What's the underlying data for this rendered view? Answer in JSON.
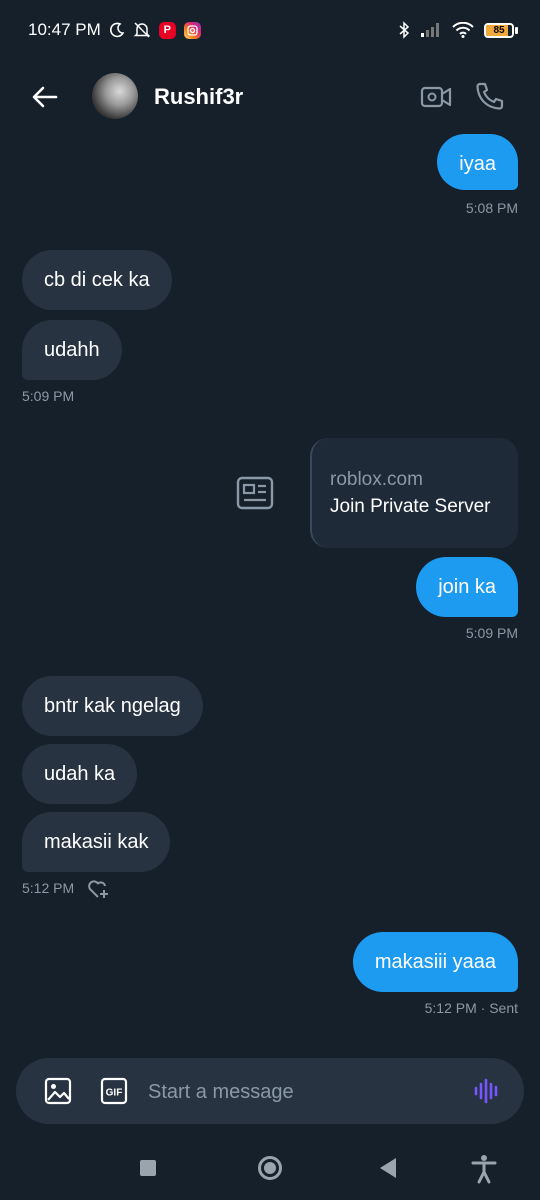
{
  "status_bar": {
    "time": "10:47 PM",
    "battery_level": "85",
    "icons": [
      "moon-icon",
      "bell-off-icon",
      "pinterest-icon",
      "instagram-icon",
      "bluetooth-icon",
      "signal-icon",
      "wifi-icon",
      "battery-icon"
    ],
    "colors": {
      "battery_fill": "#f2a93b",
      "pinterest": "#e60023",
      "instagram": "#d62976"
    }
  },
  "header": {
    "contact_name": "Rushif3r",
    "icons": [
      "back-arrow-icon",
      "avatar",
      "video-call-icon",
      "phone-icon"
    ]
  },
  "messages": [
    {
      "direction": "out",
      "text": "iyaa"
    },
    {
      "timestamp": "5:08 PM",
      "direction": "out"
    },
    {
      "direction": "in",
      "text": "cb di cek ka"
    },
    {
      "direction": "in",
      "text": "udahh"
    },
    {
      "timestamp": "5:09 PM",
      "direction": "in"
    },
    {
      "direction": "out",
      "type": "link",
      "domain": "roblox.com",
      "title": "Join Private Server"
    },
    {
      "direction": "out",
      "text": "join ka"
    },
    {
      "timestamp": "5:09 PM",
      "direction": "out"
    },
    {
      "direction": "in",
      "text": "bntr kak ngelag"
    },
    {
      "direction": "in",
      "text": "udah ka"
    },
    {
      "direction": "in",
      "text": "makasii kak"
    },
    {
      "timestamp": "5:12 PM",
      "direction": "in"
    },
    {
      "direction": "out",
      "text": "makasiii yaaa"
    },
    {
      "timestamp": "5:12 PM · Sent",
      "direction": "out"
    }
  ],
  "composer": {
    "placeholder": "Start a message",
    "gif_label": "GIF",
    "icons": [
      "image-icon",
      "gif-icon",
      "voice-message-icon"
    ],
    "voice_color": "#7856ff"
  },
  "nav_bar": {
    "icons": [
      "recents-square-icon",
      "home-circle-icon",
      "back-triangle-icon",
      "accessibility-icon"
    ]
  },
  "colors": {
    "background": "#15202b",
    "outgoing_bubble": "#1d9bf0",
    "incoming_bubble": "#273340",
    "timestamp": "#8b98a5"
  }
}
